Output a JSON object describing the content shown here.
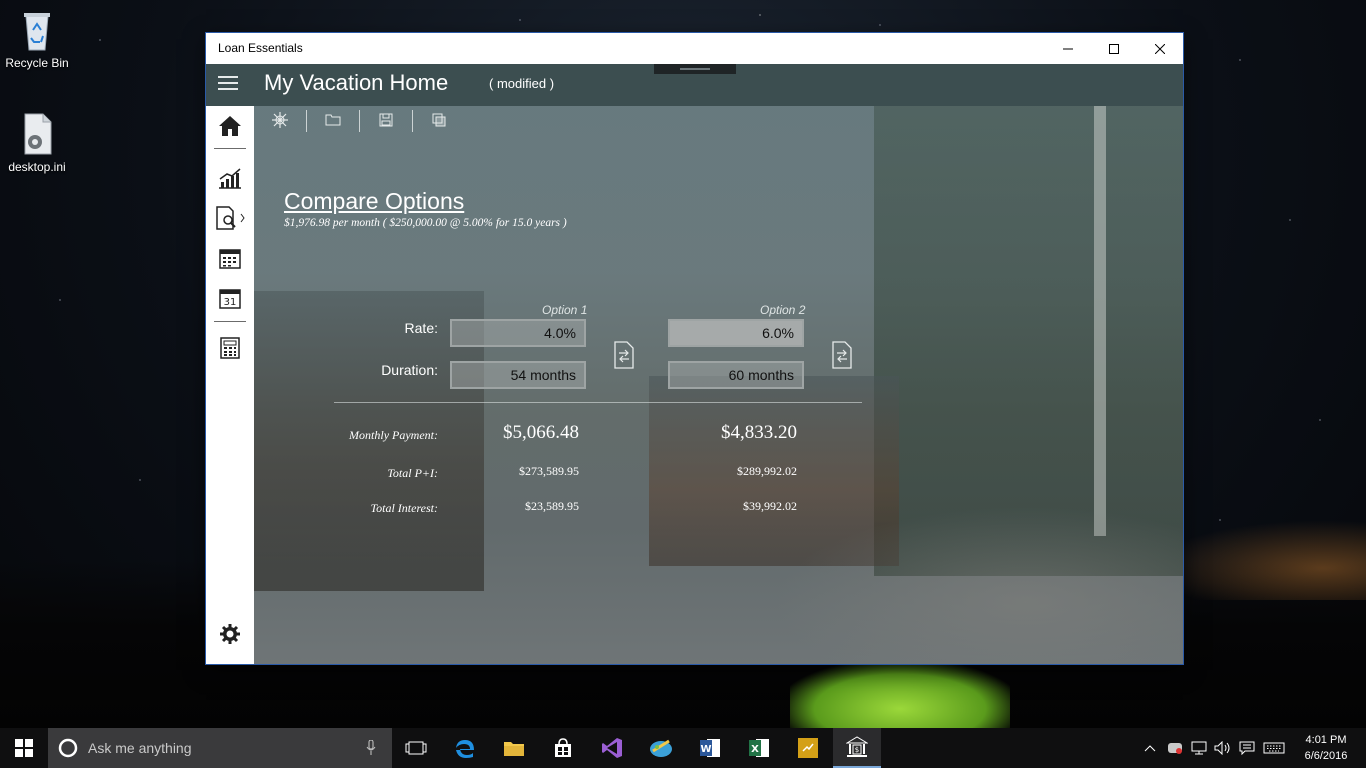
{
  "desktop": {
    "icons": [
      {
        "label": "Recycle Bin"
      },
      {
        "label": "desktop.ini"
      }
    ]
  },
  "window": {
    "title": "Loan Essentials",
    "controls": {
      "minimize": "–",
      "maximize": "☐",
      "close": "✕"
    }
  },
  "appbar": {
    "title": "My Vacation Home",
    "status": "( modified )"
  },
  "sidebar": {
    "items": [
      "home-icon",
      "chart-icon",
      "document-search-icon",
      "calendar-icon",
      "schedule-icon",
      "calculator-icon"
    ],
    "bottom": "gear-icon"
  },
  "toolbar": {
    "items": [
      "new-icon",
      "open-folder-icon",
      "save-icon",
      "copy-icon"
    ]
  },
  "compare": {
    "heading": "Compare Options",
    "summary": "$1,976.98  per month (  $250,000.00  @  5.00%  for  15.0 years  )",
    "option1_label": "Option 1",
    "option2_label": "Option 2",
    "rate_label": "Rate:",
    "duration_label": "Duration:",
    "option1": {
      "rate": "4.0%",
      "duration": "54 months"
    },
    "option2": {
      "rate": "6.0%",
      "duration": "60 months"
    },
    "results": {
      "monthly_payment_label": "Monthly Payment:",
      "total_pi_label": "Total P+I:",
      "total_interest_label": "Total Interest:",
      "option1": {
        "monthly_payment": "$5,066.48",
        "total_pi": "$273,589.95",
        "total_interest": "$23,589.95"
      },
      "option2": {
        "monthly_payment": "$4,833.20",
        "total_pi": "$289,992.02",
        "total_interest": "$39,992.02"
      }
    }
  },
  "taskbar": {
    "search_placeholder": "Ask me anything",
    "apps": [
      "task-view-icon",
      "edge-icon",
      "file-explorer-icon",
      "store-icon",
      "visual-studio-icon",
      "paint-icon",
      "word-icon",
      "excel-icon",
      "app-icon",
      "loan-essentials-icon"
    ],
    "time": "4:01 PM",
    "date": "6/6/2016"
  },
  "colors": {
    "appbar": "#3c4e50",
    "sidebar": "#ffffff",
    "taskbar": "#0f0f10",
    "accent": "#7aa7d8"
  }
}
